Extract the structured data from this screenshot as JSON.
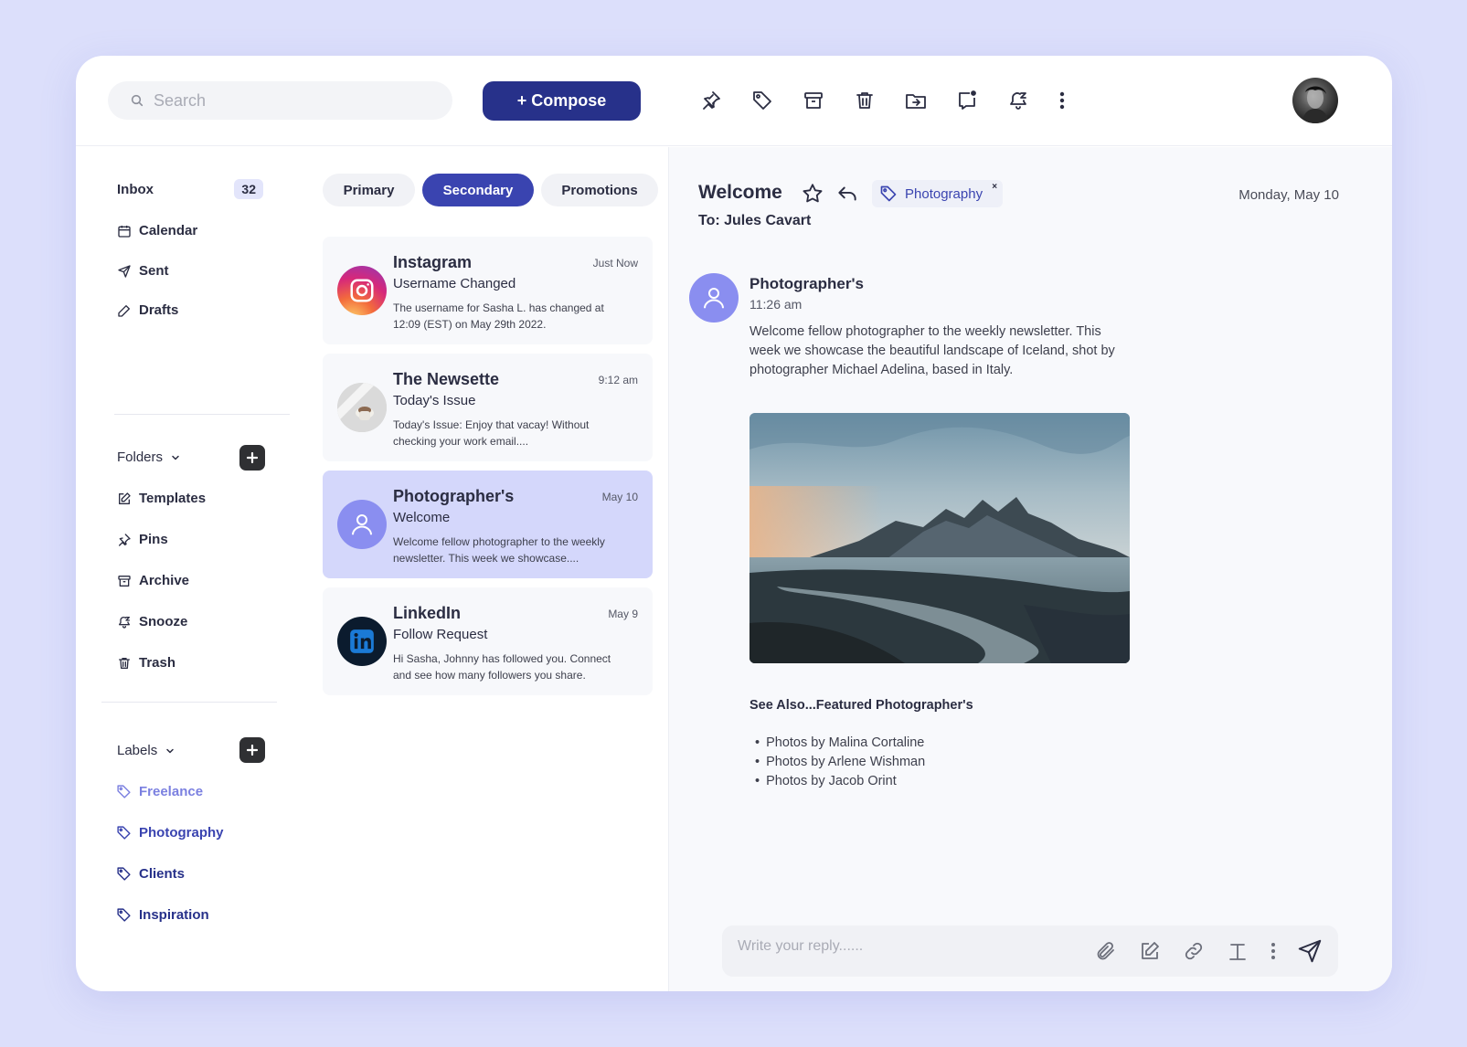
{
  "toolbar": {
    "search_placeholder": "Search",
    "compose_label": "+ Compose",
    "icons": [
      "pin-icon",
      "tag-icon",
      "archive-icon",
      "trash-icon",
      "move-to-folder-icon",
      "mark-unread-icon",
      "snooze-icon",
      "more-vertical-icon"
    ]
  },
  "sidebar": {
    "inbox": {
      "label": "Inbox",
      "count": "32"
    },
    "nav": [
      {
        "label": "Calendar",
        "icon": "calendar-icon"
      },
      {
        "label": "Sent",
        "icon": "send-icon"
      },
      {
        "label": "Drafts",
        "icon": "pencil-icon"
      }
    ],
    "folders_label": "Folders",
    "folders": [
      {
        "label": "Templates",
        "icon": "edit-icon"
      },
      {
        "label": "Pins",
        "icon": "pin-icon"
      },
      {
        "label": "Archive",
        "icon": "archive-icon"
      },
      {
        "label": "Snooze",
        "icon": "snooze-icon"
      },
      {
        "label": "Trash",
        "icon": "trash-icon"
      }
    ],
    "labels_label": "Labels",
    "labels": [
      {
        "label": "Freelance",
        "color": "#7b80e0"
      },
      {
        "label": "Photography",
        "color": "#3a44b0"
      },
      {
        "label": "Clients",
        "color": "#27318a"
      },
      {
        "label": "Inspiration",
        "color": "#27318a"
      }
    ]
  },
  "tabs": [
    {
      "label": "Primary",
      "active": false
    },
    {
      "label": "Secondary",
      "active": true
    },
    {
      "label": "Promotions",
      "active": false
    }
  ],
  "mails": [
    {
      "sender": "Instagram",
      "time": "Just Now",
      "subject": "Username Changed",
      "preview": "The username for Sasha L. has changed at 12:09 (EST) on May 29th 2022."
    },
    {
      "sender": "The Newsette",
      "time": "9:12 am",
      "subject": "Today's Issue",
      "preview": "Today's Issue: Enjoy that vacay! Without checking your work email...."
    },
    {
      "sender": "Photographer's",
      "time": "May 10",
      "subject": "Welcome",
      "preview": "Welcome fellow photographer to the weekly newsletter. This week we showcase....",
      "selected": true
    },
    {
      "sender": "LinkedIn",
      "time": "May 9",
      "subject": "Follow Request",
      "preview": "Hi Sasha, Johnny has followed you. Connect and see how many followers you share."
    }
  ],
  "message": {
    "title": "Welcome",
    "tag": "Photography",
    "tag_close": "×",
    "date": "Monday, May 10",
    "to": "To: Jules Cavart",
    "sender": "Photographer's",
    "time": "11:26 am",
    "body": "Welcome fellow photographer to the weekly newsletter. This week we showcase the beautiful landscape of Iceland, shot by photographer Michael Adelina, based in Italy.",
    "see_also": "See Also...Featured Photographer's",
    "links": [
      "Photos by Malina Cortaline",
      "Photos by Arlene Wishman",
      "Photos by Jacob Orint"
    ]
  },
  "reply": {
    "placeholder": "Write your reply......",
    "icons": [
      "paperclip-icon",
      "edit-icon",
      "link-icon",
      "text-format-icon",
      "more-vertical-icon",
      "send-icon"
    ]
  },
  "colors": {
    "accent": "#3a44b0",
    "compose": "#27318a",
    "selected_mail": "#d4d7fb",
    "background": "#dcdffb"
  }
}
